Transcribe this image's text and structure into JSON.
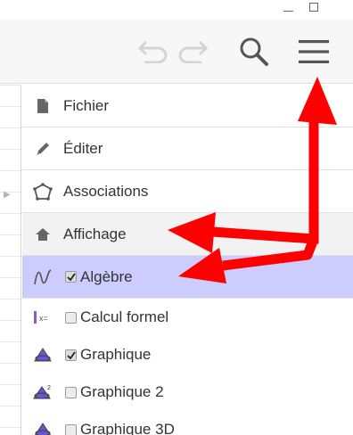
{
  "window_controls": {
    "minimize_icon": "minimize-icon",
    "maximize_icon": "maximize-icon"
  },
  "toolbar": {
    "undo_icon": "undo-icon",
    "redo_icon": "redo-icon",
    "search_icon": "search-icon",
    "menu_icon": "hamburger-menu-icon"
  },
  "menu": {
    "items": [
      {
        "label": "Fichier",
        "icon": "file-icon"
      },
      {
        "label": "Éditer",
        "icon": "pencil-icon"
      },
      {
        "label": "Associations",
        "icon": "polygon-icon"
      },
      {
        "label": "Affichage",
        "icon": "home-icon"
      }
    ],
    "views": [
      {
        "label": "Algèbre",
        "checked": true,
        "icon": "algebra-view-icon"
      },
      {
        "label": "Calcul formel",
        "checked": false,
        "icon": "cas-view-icon",
        "icon_text": "x="
      },
      {
        "label": "Graphique",
        "checked": true,
        "icon": "graphics-view-icon"
      },
      {
        "label": "Graphique 2",
        "checked": false,
        "icon": "graphics-2-view-icon"
      },
      {
        "label": "Graphique 3D",
        "checked": false,
        "icon": "graphics-3d-view-icon"
      }
    ]
  },
  "colors": {
    "annotation_arrow": "#ff0000",
    "selected_row": "#ccccff",
    "section_row": "#f2f2f2",
    "toolbar_bg": "#f7f7f7",
    "geo_icon_purple": "#6557d2"
  }
}
